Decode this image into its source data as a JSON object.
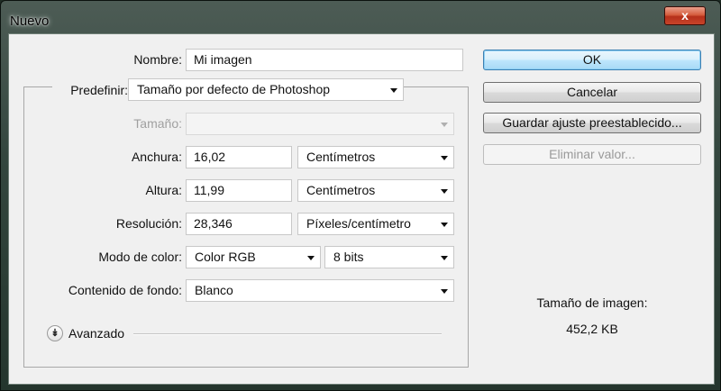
{
  "window": {
    "title": "Nuevo",
    "close_glyph": "x",
    "close_icon": "close-icon"
  },
  "form": {
    "nombre": {
      "label": "Nombre:",
      "value": "Mi imagen"
    },
    "predefinir": {
      "label": "Predefinir:",
      "value": "Tamaño por defecto de Photoshop"
    },
    "tamano": {
      "label": "Tamaño:",
      "value": ""
    },
    "anchura": {
      "label": "Anchura:",
      "value": "16,02",
      "unit": "Centímetros"
    },
    "altura": {
      "label": "Altura:",
      "value": "11,99",
      "unit": "Centímetros"
    },
    "resolucion": {
      "label": "Resolución:",
      "value": "28,346",
      "unit": "Píxeles/centímetro"
    },
    "modo_color": {
      "label": "Modo de color:",
      "value": "Color RGB",
      "bits": "8 bits"
    },
    "contenido_fondo": {
      "label": "Contenido de fondo:",
      "value": "Blanco"
    },
    "avanzado": {
      "label": "Avanzado",
      "icon": "chevron-double-down-icon"
    }
  },
  "buttons": {
    "ok": "OK",
    "cancelar": "Cancelar",
    "guardar": "Guardar ajuste preestablecido...",
    "eliminar": "Eliminar valor..."
  },
  "info": {
    "size_label": "Tamaño de imagen:",
    "size_value": "452,2 KB"
  },
  "colors": {
    "accent_border": "#3c7fb1",
    "default_button": "#bee6fd",
    "dialog_bg": "#f0f0f0"
  }
}
